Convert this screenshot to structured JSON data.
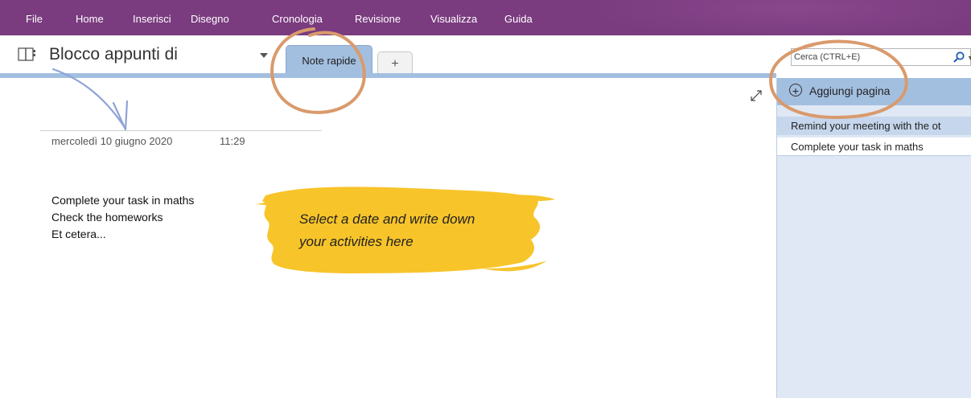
{
  "menubar": {
    "items": [
      "File",
      "Home",
      "Inserisci",
      "Disegno",
      "Cronologia",
      "Revisione",
      "Visualizza",
      "Guida"
    ]
  },
  "notebook": {
    "title": "Blocco appunti di",
    "icon": "notebook-icon",
    "tabs": [
      {
        "label": "Note rapide",
        "active": true
      },
      {
        "label": "+",
        "active": false
      }
    ]
  },
  "search": {
    "placeholder": "Cerca (CTRL+E)",
    "icon": "search-icon"
  },
  "pages_panel": {
    "add_label": "Aggiungi pagina",
    "pages": [
      {
        "title": "Remind your meeting with the ot",
        "selected": true
      },
      {
        "title": "Complete your task in maths",
        "selected": false
      }
    ]
  },
  "note": {
    "date": "mercoledì 10 giugno 2020",
    "time": "11:29",
    "lines": [
      "Complete your task in maths",
      "Check the homeworks",
      "Et cetera..."
    ]
  },
  "annotation": {
    "lines": [
      "Select a date and write down",
      "your activities here"
    ]
  },
  "colors": {
    "menubar": "#7a3b7f",
    "tab_blue": "#a3bfe0",
    "panel_bg": "#dfe8f4",
    "highlight_yellow": "#f7c11f",
    "circle_orange": "#d99a6c",
    "arrow": "#8fa3d8"
  }
}
